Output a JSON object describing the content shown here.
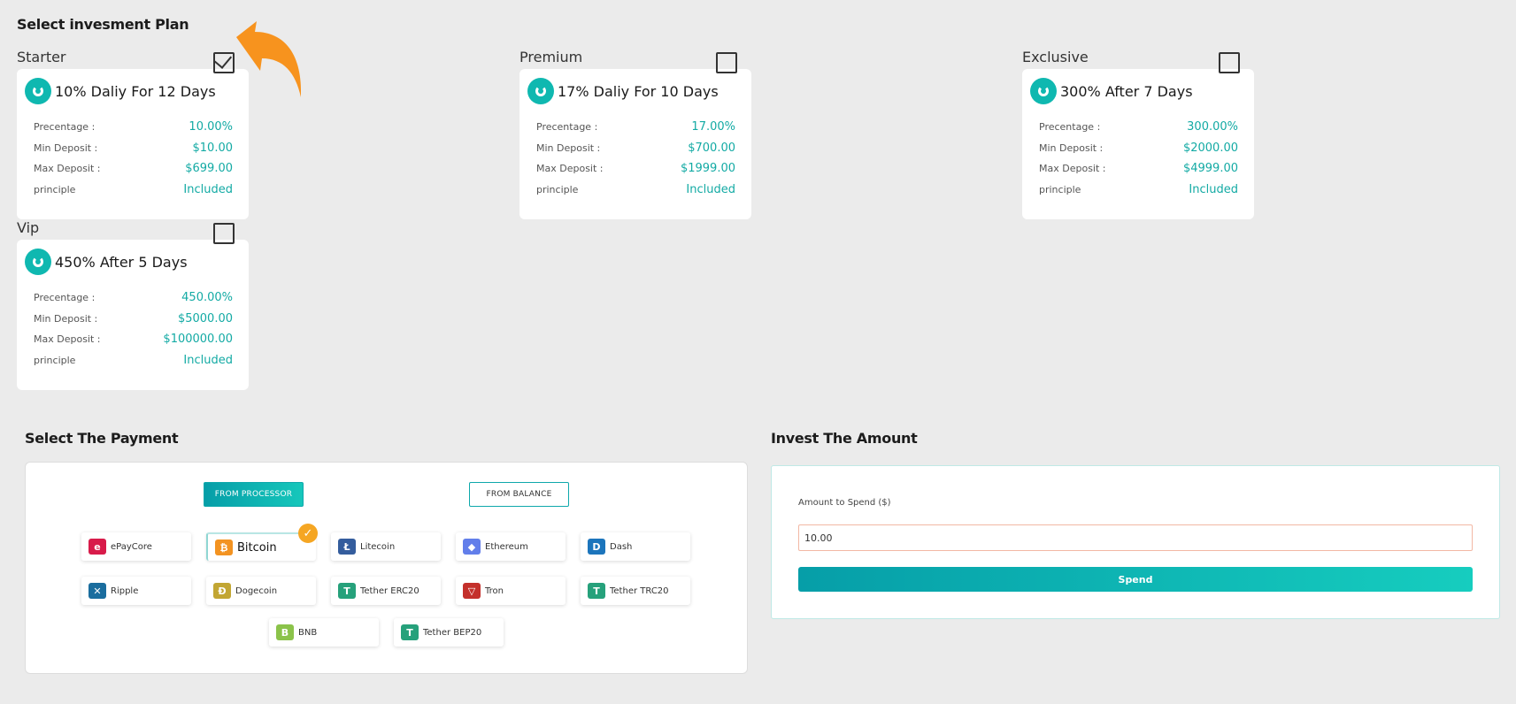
{
  "plans_section": {
    "title": "Select invesment Plan"
  },
  "plans": [
    {
      "name": "Starter",
      "title": "10% Daliy For 12 Days",
      "checked": true,
      "rows": [
        {
          "label": "Precentage :",
          "value": "10.00%"
        },
        {
          "label": "Min Deposit :",
          "value": "$10.00"
        },
        {
          "label": "Max Deposit :",
          "value": "$699.00"
        },
        {
          "label": "principle",
          "value": "Included"
        }
      ]
    },
    {
      "name": "Premium",
      "title": "17% Daliy For 10 Days",
      "checked": false,
      "rows": [
        {
          "label": "Precentage :",
          "value": "17.00%"
        },
        {
          "label": "Min Deposit :",
          "value": "$700.00"
        },
        {
          "label": "Max Deposit :",
          "value": "$1999.00"
        },
        {
          "label": "principle",
          "value": "Included"
        }
      ]
    },
    {
      "name": "Exclusive",
      "title": "300% After 7 Days",
      "checked": false,
      "rows": [
        {
          "label": "Precentage :",
          "value": "300.00%"
        },
        {
          "label": "Min Deposit :",
          "value": "$2000.00"
        },
        {
          "label": "Max Deposit :",
          "value": "$4999.00"
        },
        {
          "label": "principle",
          "value": "Included"
        }
      ]
    },
    {
      "name": "Vip",
      "title": "450% After 5 Days",
      "checked": false,
      "rows": [
        {
          "label": "Precentage :",
          "value": "450.00%"
        },
        {
          "label": "Min Deposit :",
          "value": "$5000.00"
        },
        {
          "label": "Max Deposit :",
          "value": "$100000.00"
        },
        {
          "label": "principle",
          "value": "Included"
        }
      ]
    }
  ],
  "payment": {
    "title": "Select The Payment",
    "from_processor": "FROM PROCESSOR",
    "from_balance": "FROM BALANCE",
    "methods": [
      {
        "label": "ePayCore",
        "icon": "epaycore-icon",
        "color": "#d81b4a",
        "glyph": "e"
      },
      {
        "label": "Bitcoin",
        "icon": "bitcoin-icon",
        "color": "#f39321",
        "glyph": "₿",
        "selected": true
      },
      {
        "label": "Litecoin",
        "icon": "litecoin-icon",
        "color": "#345d9d",
        "glyph": "Ł"
      },
      {
        "label": "Ethereum",
        "icon": "ethereum-icon",
        "color": "#627eea",
        "glyph": "◆"
      },
      {
        "label": "Dash",
        "icon": "dash-icon",
        "color": "#1c75bc",
        "glyph": "D"
      },
      {
        "label": "Ripple",
        "icon": "ripple-icon",
        "color": "#1a6d9e",
        "glyph": "✕"
      },
      {
        "label": "Dogecoin",
        "icon": "dogecoin-icon",
        "color": "#c2a633",
        "glyph": "Ð"
      },
      {
        "label": "Tether ERC20",
        "icon": "tether-erc20-icon",
        "color": "#26a17b",
        "glyph": "T"
      },
      {
        "label": "Tron",
        "icon": "tron-icon",
        "color": "#c4302b",
        "glyph": "▽"
      },
      {
        "label": "Tether TRC20",
        "icon": "tether-trc20-icon",
        "color": "#26a17b",
        "glyph": "T"
      },
      {
        "label": "BNB",
        "icon": "bnb-icon",
        "color": "#8bc34a",
        "glyph": "B"
      },
      {
        "label": "Tether BEP20",
        "icon": "tether-bep20-icon",
        "color": "#26a17b",
        "glyph": "T"
      }
    ]
  },
  "invest": {
    "title": "Invest The Amount",
    "amount_label": "Amount to Spend ($)",
    "amount_value": "10.00",
    "spend_label": "Spend"
  },
  "colors": {
    "accent": "#13aaa4",
    "badge": "#f5a623",
    "arrow": "#f7931e"
  }
}
